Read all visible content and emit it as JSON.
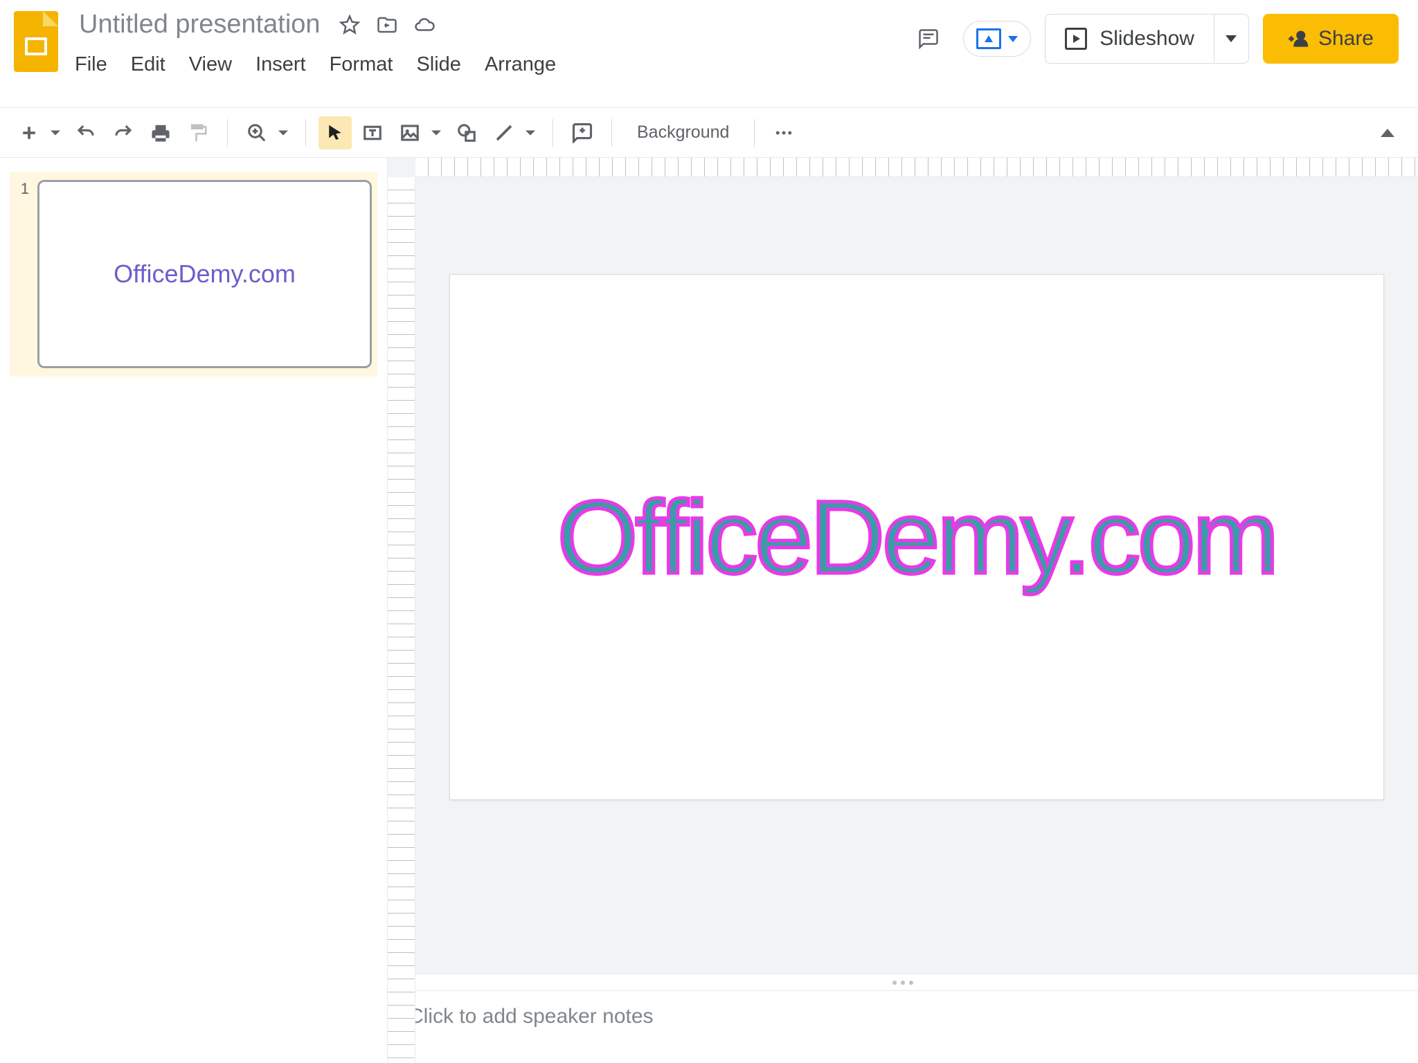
{
  "header": {
    "doc_title": "Untitled presentation",
    "menus": [
      "File",
      "Edit",
      "View",
      "Insert",
      "Format",
      "Slide",
      "Arrange"
    ],
    "slideshow_label": "Slideshow",
    "share_label": "Share"
  },
  "toolbar": {
    "background_label": "Background"
  },
  "filmstrip": {
    "slides": [
      {
        "number": "1",
        "text": "OfficeDemy.com"
      }
    ]
  },
  "canvas": {
    "wordart_text": "OfficeDemy.com"
  },
  "notes": {
    "placeholder": "Click to add speaker notes"
  }
}
